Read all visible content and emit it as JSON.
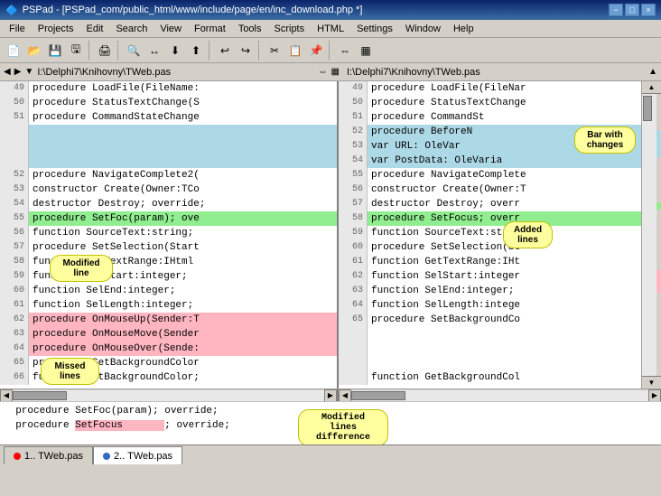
{
  "titlebar": {
    "text": "PSPad - [PSPad_com/public_html/www/include/page/en/inc_download.php *]",
    "icon": "🔷",
    "min_label": "−",
    "max_label": "□",
    "close_label": "×",
    "restore_label": "❐",
    "app_close": "×"
  },
  "menu": {
    "items": [
      "File",
      "Projects",
      "Edit",
      "Search",
      "View",
      "Format",
      "Tools",
      "Scripts",
      "HTML",
      "Settings",
      "Window",
      "Help"
    ]
  },
  "path_left": "I:\\Delphi7\\Knihovny\\TWeb.pas",
  "path_right": "I:\\Delphi7\\Knihovny\\TWeb.pas",
  "callouts": {
    "bar_with_changes": "Bar with\nchanges",
    "added_lines": "Added\nlines",
    "modified_line": "Modified\nline",
    "missed_lines": "Missed\nlines",
    "modified_lines_diff": "Modified lines\ndifference"
  },
  "tabs": [
    {
      "id": 1,
      "label": "1.. TWeb.pas",
      "active": false,
      "dot_color": "red"
    },
    {
      "id": 2,
      "label": "2.. TWeb.pas",
      "active": true,
      "dot_color": "blue"
    }
  ],
  "left_lines": [
    {
      "num": "49",
      "content": "  procedure LoadFile(FileName:",
      "style": "normal"
    },
    {
      "num": "50",
      "content": "  procedure StatusTextChange(S",
      "style": "normal"
    },
    {
      "num": "51",
      "content": "  procedure CommandStateChange",
      "style": "normal"
    },
    {
      "num": "",
      "content": "",
      "style": "blue"
    },
    {
      "num": "",
      "content": "",
      "style": "blue"
    },
    {
      "num": "",
      "content": "",
      "style": "blue"
    },
    {
      "num": "52",
      "content": "  procedure NavigateComplete2(",
      "style": "normal"
    },
    {
      "num": "53",
      "content": "  constructor Create(Owner:TCo",
      "style": "normal"
    },
    {
      "num": "54",
      "content": "  destructor Destroy; override;",
      "style": "normal"
    },
    {
      "num": "55",
      "content": "  procedure SetFoc(param); ove",
      "style": "green"
    },
    {
      "num": "56",
      "content": "  function SourceText:string;",
      "style": "normal"
    },
    {
      "num": "57",
      "content": "  procedure SetSelection(Start",
      "style": "normal"
    },
    {
      "num": "58",
      "content": "  function GetTextRange:IHtml",
      "style": "normal"
    },
    {
      "num": "59",
      "content": "  function SelStart:integer;",
      "style": "normal"
    },
    {
      "num": "60",
      "content": "  function SelEnd:integer;",
      "style": "normal"
    },
    {
      "num": "61",
      "content": "  function SelLength:integer;",
      "style": "normal"
    },
    {
      "num": "62",
      "content": "  procedure OnMouseUp(Sender:T",
      "style": "red"
    },
    {
      "num": "63",
      "content": "  procedure OnMouseMove(Sender",
      "style": "red"
    },
    {
      "num": "64",
      "content": "  procedure OnMouseOver(Sende:",
      "style": "red"
    },
    {
      "num": "65",
      "content": "  procedure SetBackgroundColor",
      "style": "normal"
    },
    {
      "num": "66",
      "content": "  function GetBackgroundColor;",
      "style": "normal"
    }
  ],
  "right_lines": [
    {
      "num": "49",
      "content": "  procedure LoadFile(FileNar",
      "style": "normal"
    },
    {
      "num": "50",
      "content": "  procedure StatusTextChange",
      "style": "normal"
    },
    {
      "num": "51",
      "content": "  procedure CommandSt",
      "style": "normal"
    },
    {
      "num": "52",
      "content": "  procedure BeforeN",
      "style": "blue"
    },
    {
      "num": "53",
      "content": "    var URL: OleVar",
      "style": "blue"
    },
    {
      "num": "54",
      "content": "    var PostData: OleVaria",
      "style": "blue"
    },
    {
      "num": "55",
      "content": "  procedure NavigateComplete",
      "style": "normal"
    },
    {
      "num": "56",
      "content": "  constructor Create(Owner:T",
      "style": "normal"
    },
    {
      "num": "57",
      "content": "  destructor Destroy; overr",
      "style": "normal"
    },
    {
      "num": "58",
      "content": "  procedure SetFocus; overr",
      "style": "green"
    },
    {
      "num": "59",
      "content": "  function SourceText:strin",
      "style": "normal"
    },
    {
      "num": "60",
      "content": "  procedure SetSelection(St",
      "style": "normal"
    },
    {
      "num": "61",
      "content": "  function GetTextRange:IHt",
      "style": "normal"
    },
    {
      "num": "62",
      "content": "  function SelStart:integer",
      "style": "normal"
    },
    {
      "num": "63",
      "content": "  function SelEnd:integer;",
      "style": "normal"
    },
    {
      "num": "64",
      "content": "  function SelLength:intege",
      "style": "normal"
    },
    {
      "num": "65",
      "content": "  procedure SetBackgroundCo",
      "style": "normal"
    },
    {
      "num": "",
      "content": "",
      "style": "normal"
    },
    {
      "num": "",
      "content": "",
      "style": "normal"
    },
    {
      "num": "",
      "content": "",
      "style": "normal"
    },
    {
      "num": "",
      "content": "  function GetBackgroundCol",
      "style": "normal"
    }
  ],
  "preview": {
    "line1": "  procedure SetFoc(param); override;",
    "line2": "  procedure SetFocus",
    "line2_highlight": "SetFocus",
    "line2_suffix": "; override;"
  }
}
